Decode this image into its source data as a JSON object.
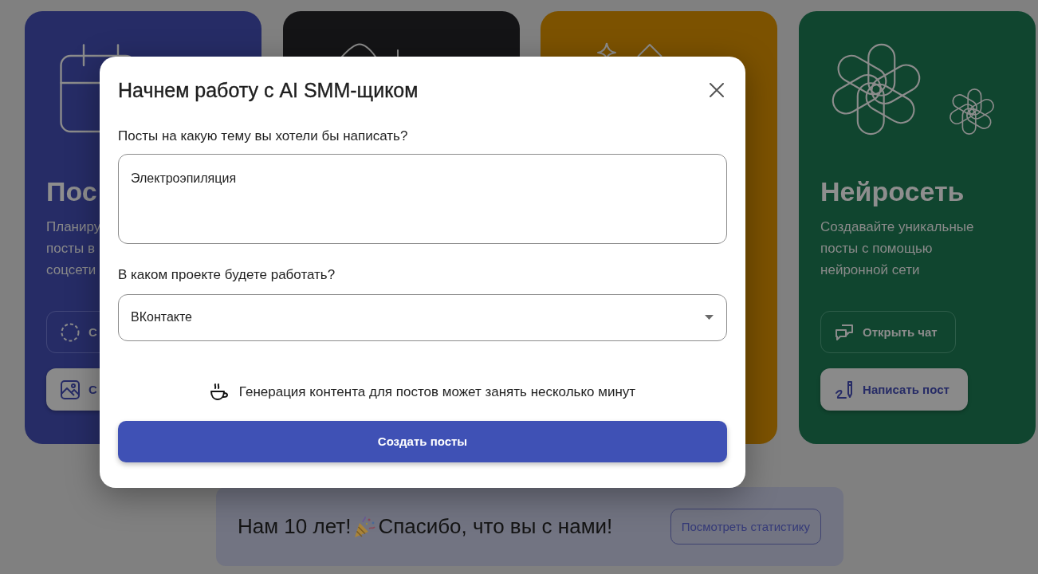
{
  "cards": [
    {
      "color": "#262c66",
      "title": "Пос",
      "description_lines": [
        "Планиру",
        "посты в",
        "соцсети"
      ],
      "buttons": [
        {
          "kind": "outlined",
          "label": "С"
        },
        {
          "kind": "filled",
          "label": "С"
        }
      ]
    },
    {
      "color": "#141416"
    },
    {
      "color": "#7c5200"
    },
    {
      "color": "#10452f",
      "title": "Нейросеть",
      "description_lines": [
        "Создавайте уникальные",
        "посты с помощью",
        "нейронной сети"
      ],
      "buttons": [
        {
          "kind": "outlined",
          "label": "Открыть чат"
        },
        {
          "kind": "filled",
          "label": "Написать пост"
        }
      ]
    }
  ],
  "banner": {
    "text_before": "Нам 10 лет!",
    "text_after": "Спасибо, что вы с нами!",
    "button": "Посмотреть статистику"
  },
  "modal": {
    "title": "Начнем работу с AI SMM-щиком",
    "fields": [
      {
        "kind": "textarea",
        "label": "Посты на какую тему вы хотели бы написать?",
        "value": "Электроэпиляция"
      },
      {
        "kind": "select",
        "label": "В каком проекте будете работать?",
        "value": "ВКонтакте"
      }
    ],
    "note": "Генерация контента для постов может занять несколько минут",
    "submit": "Создать посты"
  }
}
